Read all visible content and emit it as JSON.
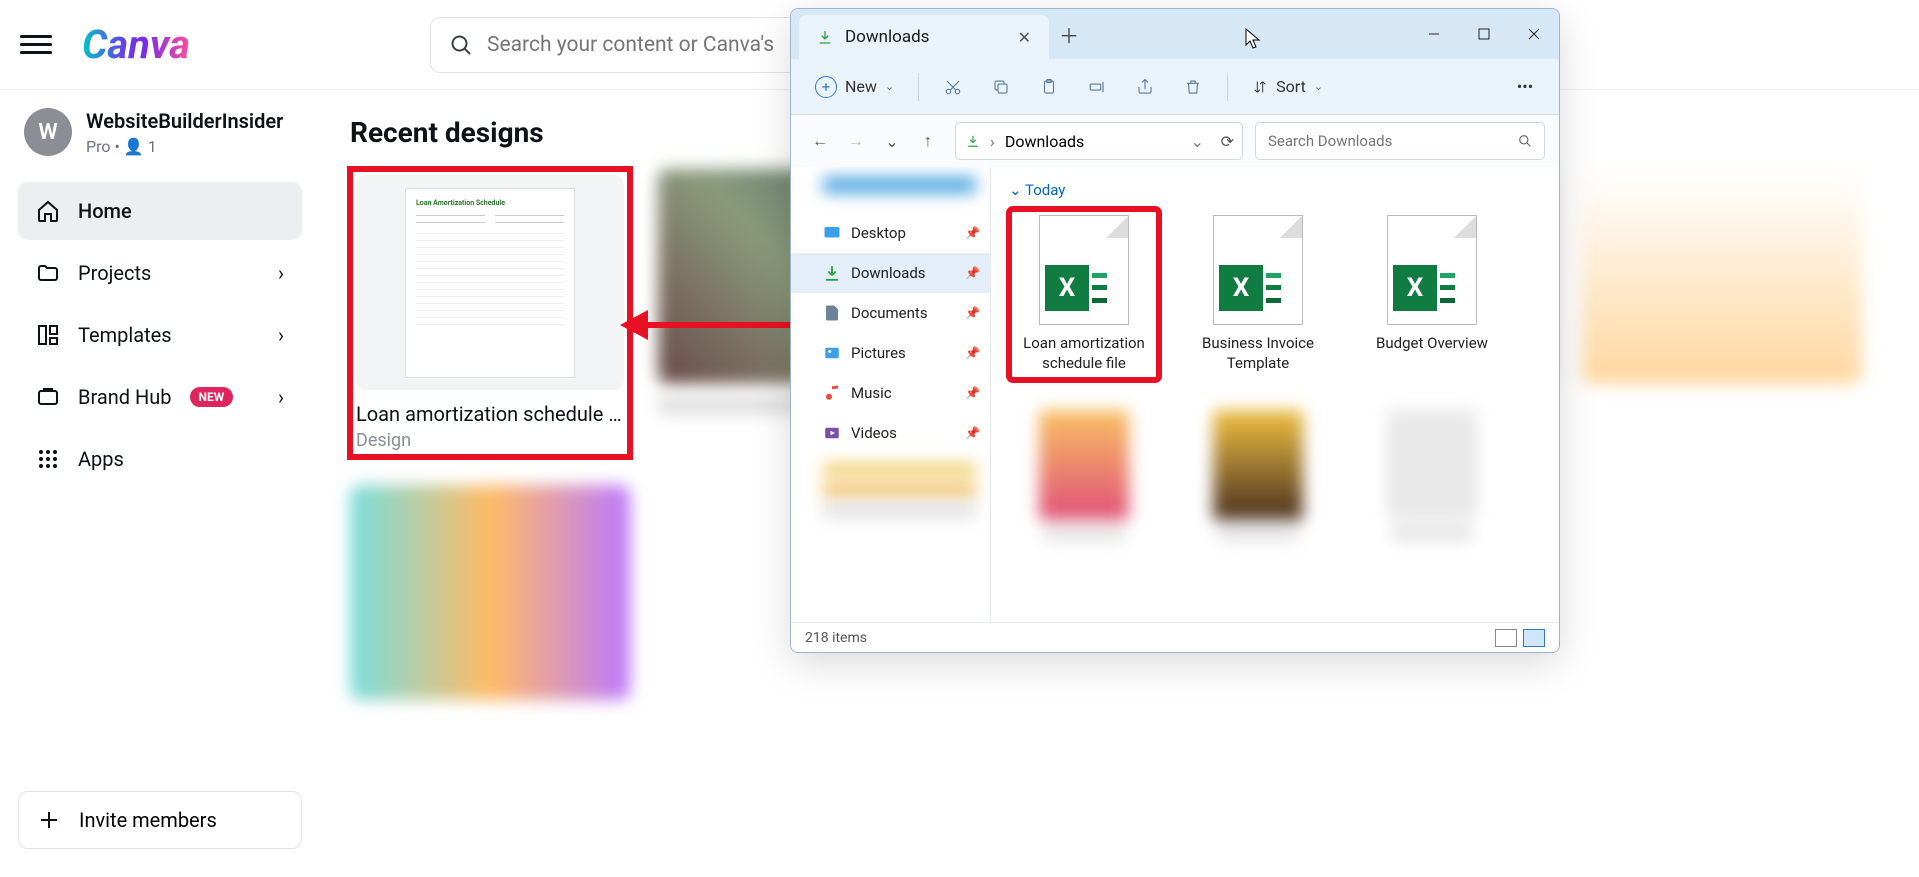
{
  "canva": {
    "search_placeholder": "Search your content or Canva's",
    "user": {
      "initial": "W",
      "name": "WebsiteBuilderInsider",
      "plan": "Pro",
      "members": "1"
    },
    "nav": {
      "home": "Home",
      "projects": "Projects",
      "templates": "Templates",
      "brandhub": "Brand Hub",
      "brandhub_badge": "NEW",
      "apps": "Apps"
    },
    "invite": "Invite members",
    "recent_heading": "Recent designs",
    "cards": [
      {
        "title": "Loan amortization schedule fil...",
        "type": "Design",
        "preview_title": "Loan Amortization Schedule"
      }
    ]
  },
  "explorer": {
    "tab_title": "Downloads",
    "toolbar": {
      "new": "New",
      "sort": "Sort"
    },
    "path_label": "Downloads",
    "search_placeholder": "Search Downloads",
    "side": {
      "desktop": "Desktop",
      "downloads": "Downloads",
      "documents": "Documents",
      "pictures": "Pictures",
      "music": "Music",
      "videos": "Videos"
    },
    "group": "Today",
    "files": [
      {
        "name": "Loan amortization schedule file"
      },
      {
        "name": "Business Invoice Template"
      },
      {
        "name": "Budget Overview"
      }
    ],
    "status": "218 items"
  }
}
